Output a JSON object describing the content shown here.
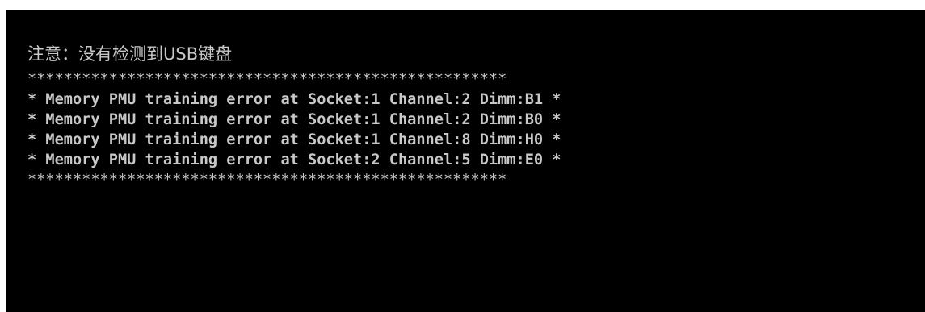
{
  "console": {
    "notice": "注意：没有检测到USB键盘",
    "border_top": "*****************************************************",
    "errors": [
      "* Memory PMU training error at Socket:1 Channel:2 Dimm:B1 *",
      "* Memory PMU training error at Socket:1 Channel:2 Dimm:B0 *",
      "* Memory PMU training error at Socket:1 Channel:8 Dimm:H0 *",
      "* Memory PMU training error at Socket:2 Channel:5 Dimm:E0 *"
    ],
    "border_bottom": "*****************************************************"
  },
  "colors": {
    "background": "#000000",
    "text": "#c8c8c8"
  }
}
